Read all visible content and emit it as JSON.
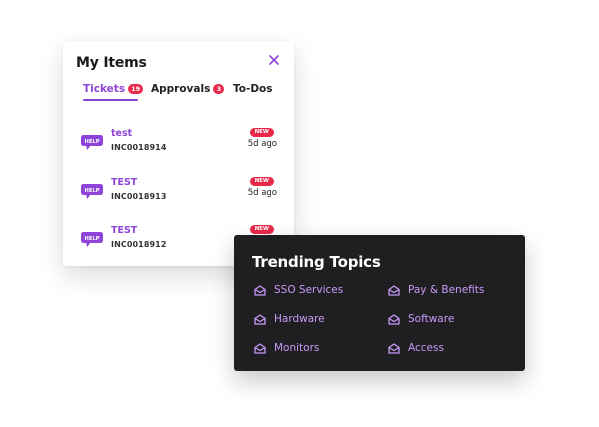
{
  "my_items": {
    "title": "My Items",
    "tabs": [
      {
        "label": "Tickets",
        "badge": "19"
      },
      {
        "label": "Approvals",
        "badge": "3"
      },
      {
        "label": "To-Dos"
      }
    ],
    "tickets": [
      {
        "icon_text": "HELP",
        "title": "test",
        "id": "INC0018914",
        "badge": "NEW",
        "time": "5d ago"
      },
      {
        "icon_text": "HELP",
        "title": "TEST",
        "id": "INC0018913",
        "badge": "NEW",
        "time": "5d ago"
      },
      {
        "icon_text": "HELP",
        "title": "TEST",
        "id": "INC0018912",
        "badge": "NEW"
      }
    ]
  },
  "trending": {
    "title": "Trending Topics",
    "topics": [
      "SSO Services",
      "Pay & Benefits",
      "Hardware",
      "Software",
      "Monitors",
      "Access"
    ]
  },
  "colors": {
    "accent": "#8e44d8",
    "badge": "#e8294a",
    "dark_panel": "#1f1f22",
    "topic_text": "#c89af7"
  }
}
